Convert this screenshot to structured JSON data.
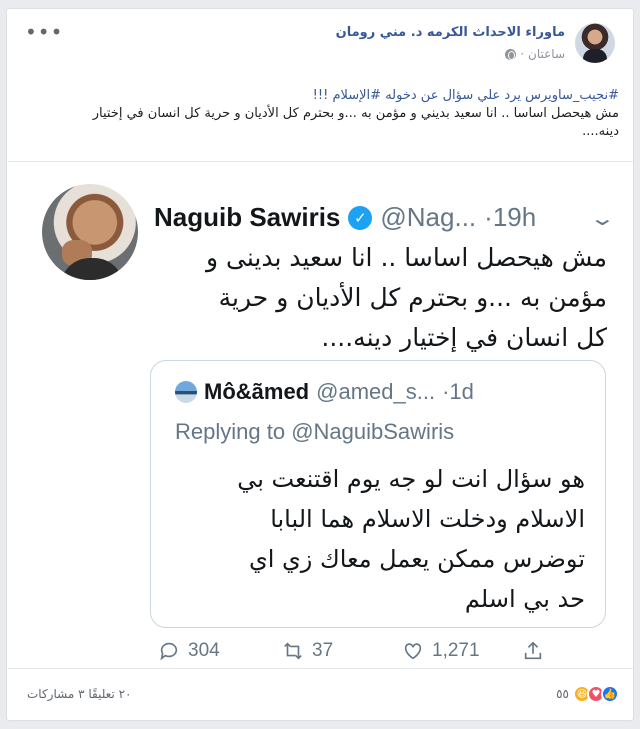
{
  "post": {
    "author": "ماوراء الاحداث الكرمه د. مني رومان",
    "time": "ساعتان",
    "more_icon": "•••",
    "hashtags_line": "#نجيب_ساويرس يرد علي سؤال عن دخوله #الإسلام !!!",
    "body_line1": "مش هيحصل اساسا .. انا سعيد بديني و مؤمن به ...و بحترم كل الأديان و حرية كل انسان في إختيار",
    "body_line2": "دينه...."
  },
  "tweet": {
    "name": "Naguib Sawiris",
    "verified_icon": "✓",
    "handle": "@Nag...",
    "time": "·19h",
    "chevron": "⌄",
    "lines": [
      "مش هيحصل اساسا .. انا سعيد بدينى و",
      "مؤمن به ...و بحترم كل الأديان و حرية",
      "كل انسان في إختيار دينه...."
    ],
    "quote": {
      "name": "Mô&ãmed",
      "handle": "@amed_s...",
      "time": "·1d",
      "replying_prefix": "Replying to",
      "replying_to": "@NaguibSawiris",
      "lines": [
        "هو سؤال انت لو جه يوم اقتنعت بي",
        "الاسلام ودخلت الاسلام هما البابا",
        "توضرس ممكن يعمل معاك زي اي",
        "حد بي اسلم"
      ]
    },
    "actions": {
      "replies": "304",
      "retweets": "37",
      "likes": "1,271"
    }
  },
  "footer": {
    "stats": "٢٠ تعليقًا  ٣ مشاركات",
    "reaction_count": "٥٥",
    "reactions": [
      "haha",
      "love",
      "like"
    ]
  }
}
